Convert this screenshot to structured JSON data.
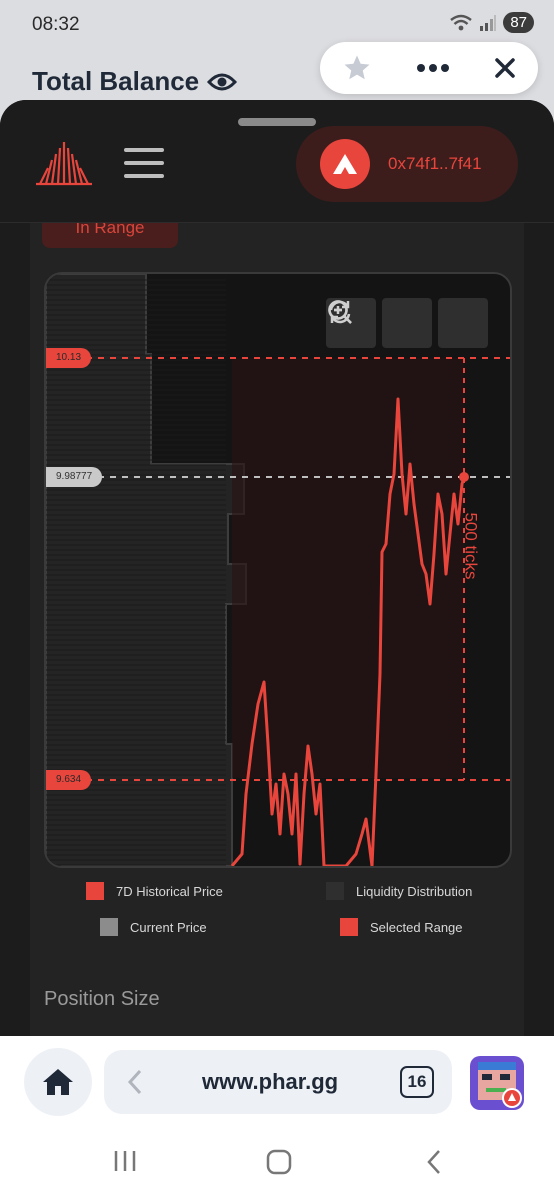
{
  "status": {
    "time": "08:32",
    "battery": "87"
  },
  "background": {
    "title": "Total Balance"
  },
  "header": {
    "wallet_address": "0x74f1..7f41"
  },
  "range_badge": "In Range",
  "chart_data": {
    "type": "line",
    "series": [
      {
        "name": "7D Historical Price",
        "color": "#e8453c"
      }
    ],
    "price_levels": {
      "upper": "10.13",
      "current": "9.98777",
      "lower": "9.634"
    },
    "tick_span_label": "500 ticks",
    "legend": [
      {
        "label": "7D Historical Price",
        "color": "#e8453c"
      },
      {
        "label": "Liquidity Distribution",
        "color": "#2f2f2f"
      },
      {
        "label": "Current Price",
        "color": "#8c8c8c"
      },
      {
        "label": "Selected Range",
        "color": "#e8453c"
      }
    ]
  },
  "section": {
    "title": "Position Size"
  },
  "browser": {
    "url": "www.phar.gg",
    "tab_count": "16"
  }
}
